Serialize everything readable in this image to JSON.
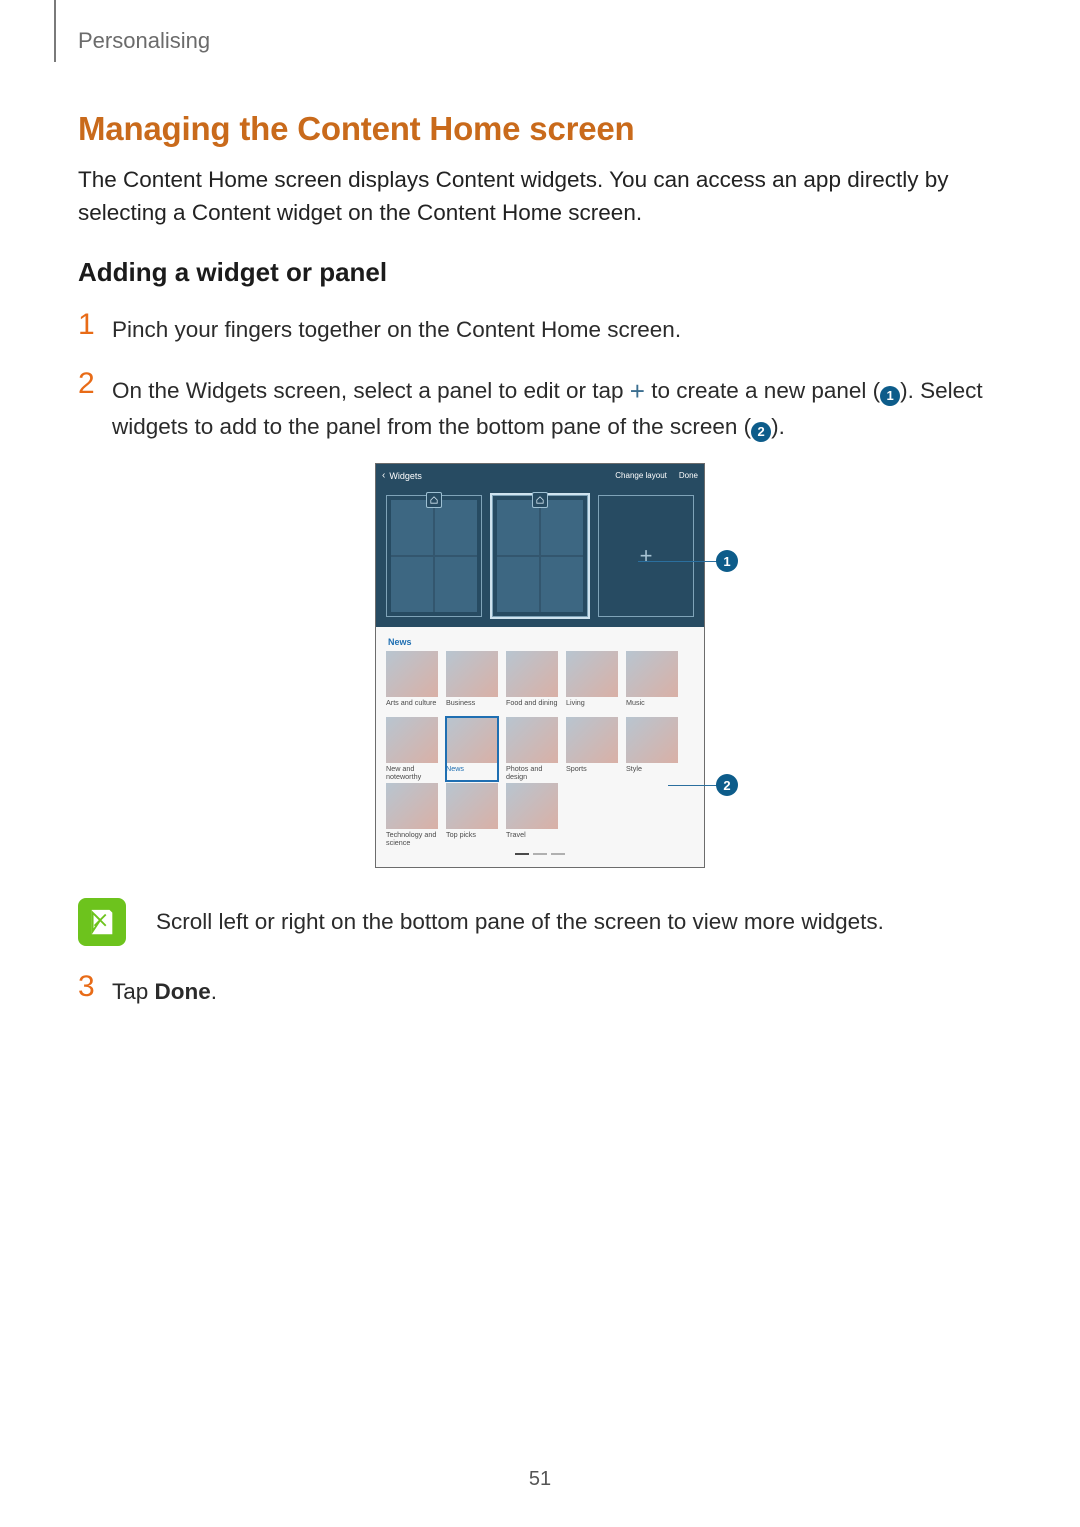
{
  "header": {
    "section": "Personalising"
  },
  "title": "Managing the Content Home screen",
  "intro_paragraph": "The Content Home screen displays Content widgets. You can access an app directly by selecting a Content widget on the Content Home screen.",
  "subsection_title": "Adding a widget or panel",
  "steps": {
    "s1_num": "1",
    "s1_text": "Pinch your fingers together on the Content Home screen.",
    "s2_num": "2",
    "s2_pre": "On the Widgets screen, select a panel to edit or tap ",
    "s2_mid1": " to create a new panel (",
    "s2_mid2": "). Select widgets to add to the panel from the bottom pane of the screen (",
    "s2_post": ").",
    "s3_num": "3",
    "s3_pre": "Tap ",
    "s3_bold": "Done",
    "s3_post": "."
  },
  "inline_badges": {
    "one": "1",
    "two": "2"
  },
  "screenshot": {
    "topbar": {
      "back_label": "Widgets",
      "change_layout": "Change layout",
      "done": "Done"
    },
    "category": "News",
    "widget_rows": [
      [
        "Arts and culture",
        "Business",
        "Food and dining",
        "Living",
        "Music"
      ],
      [
        "New and noteworthy",
        "News",
        "Photos and design",
        "Sports",
        "Style"
      ],
      [
        "Technology and science",
        "Top picks",
        "Travel"
      ]
    ],
    "selected_widget_label": "News"
  },
  "callouts": {
    "c1": "1",
    "c2": "2"
  },
  "note_text": "Scroll left or right on the bottom pane of the screen to view more widgets.",
  "page_number": "51"
}
